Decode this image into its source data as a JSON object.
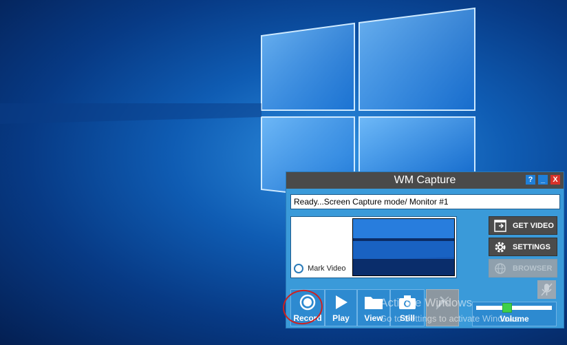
{
  "window": {
    "title": "WM Capture",
    "help_label": "?",
    "minimize_label": "_",
    "close_label": "X"
  },
  "status_text": "Ready...Screen Capture mode/ Monitor #1",
  "preview": {
    "mark_video_label": "Mark Video"
  },
  "side_buttons": {
    "get_video": "GET VIDEO",
    "settings": "SETTINGS",
    "browser": "BROWSER"
  },
  "bottom_buttons": {
    "record": "Record",
    "play": "Play",
    "view": "View",
    "still": "Still"
  },
  "volume": {
    "label": "Volume",
    "level": 0.4
  },
  "watermark": {
    "line1": "Activate Windows",
    "line2": "Go to Settings to activate Windows."
  },
  "colors": {
    "window_body": "#3a9ad9",
    "titlebar": "#4a4a4a",
    "close": "#d8322a",
    "volume_knob": "#3ed04a",
    "annotation": "#d0201e"
  }
}
